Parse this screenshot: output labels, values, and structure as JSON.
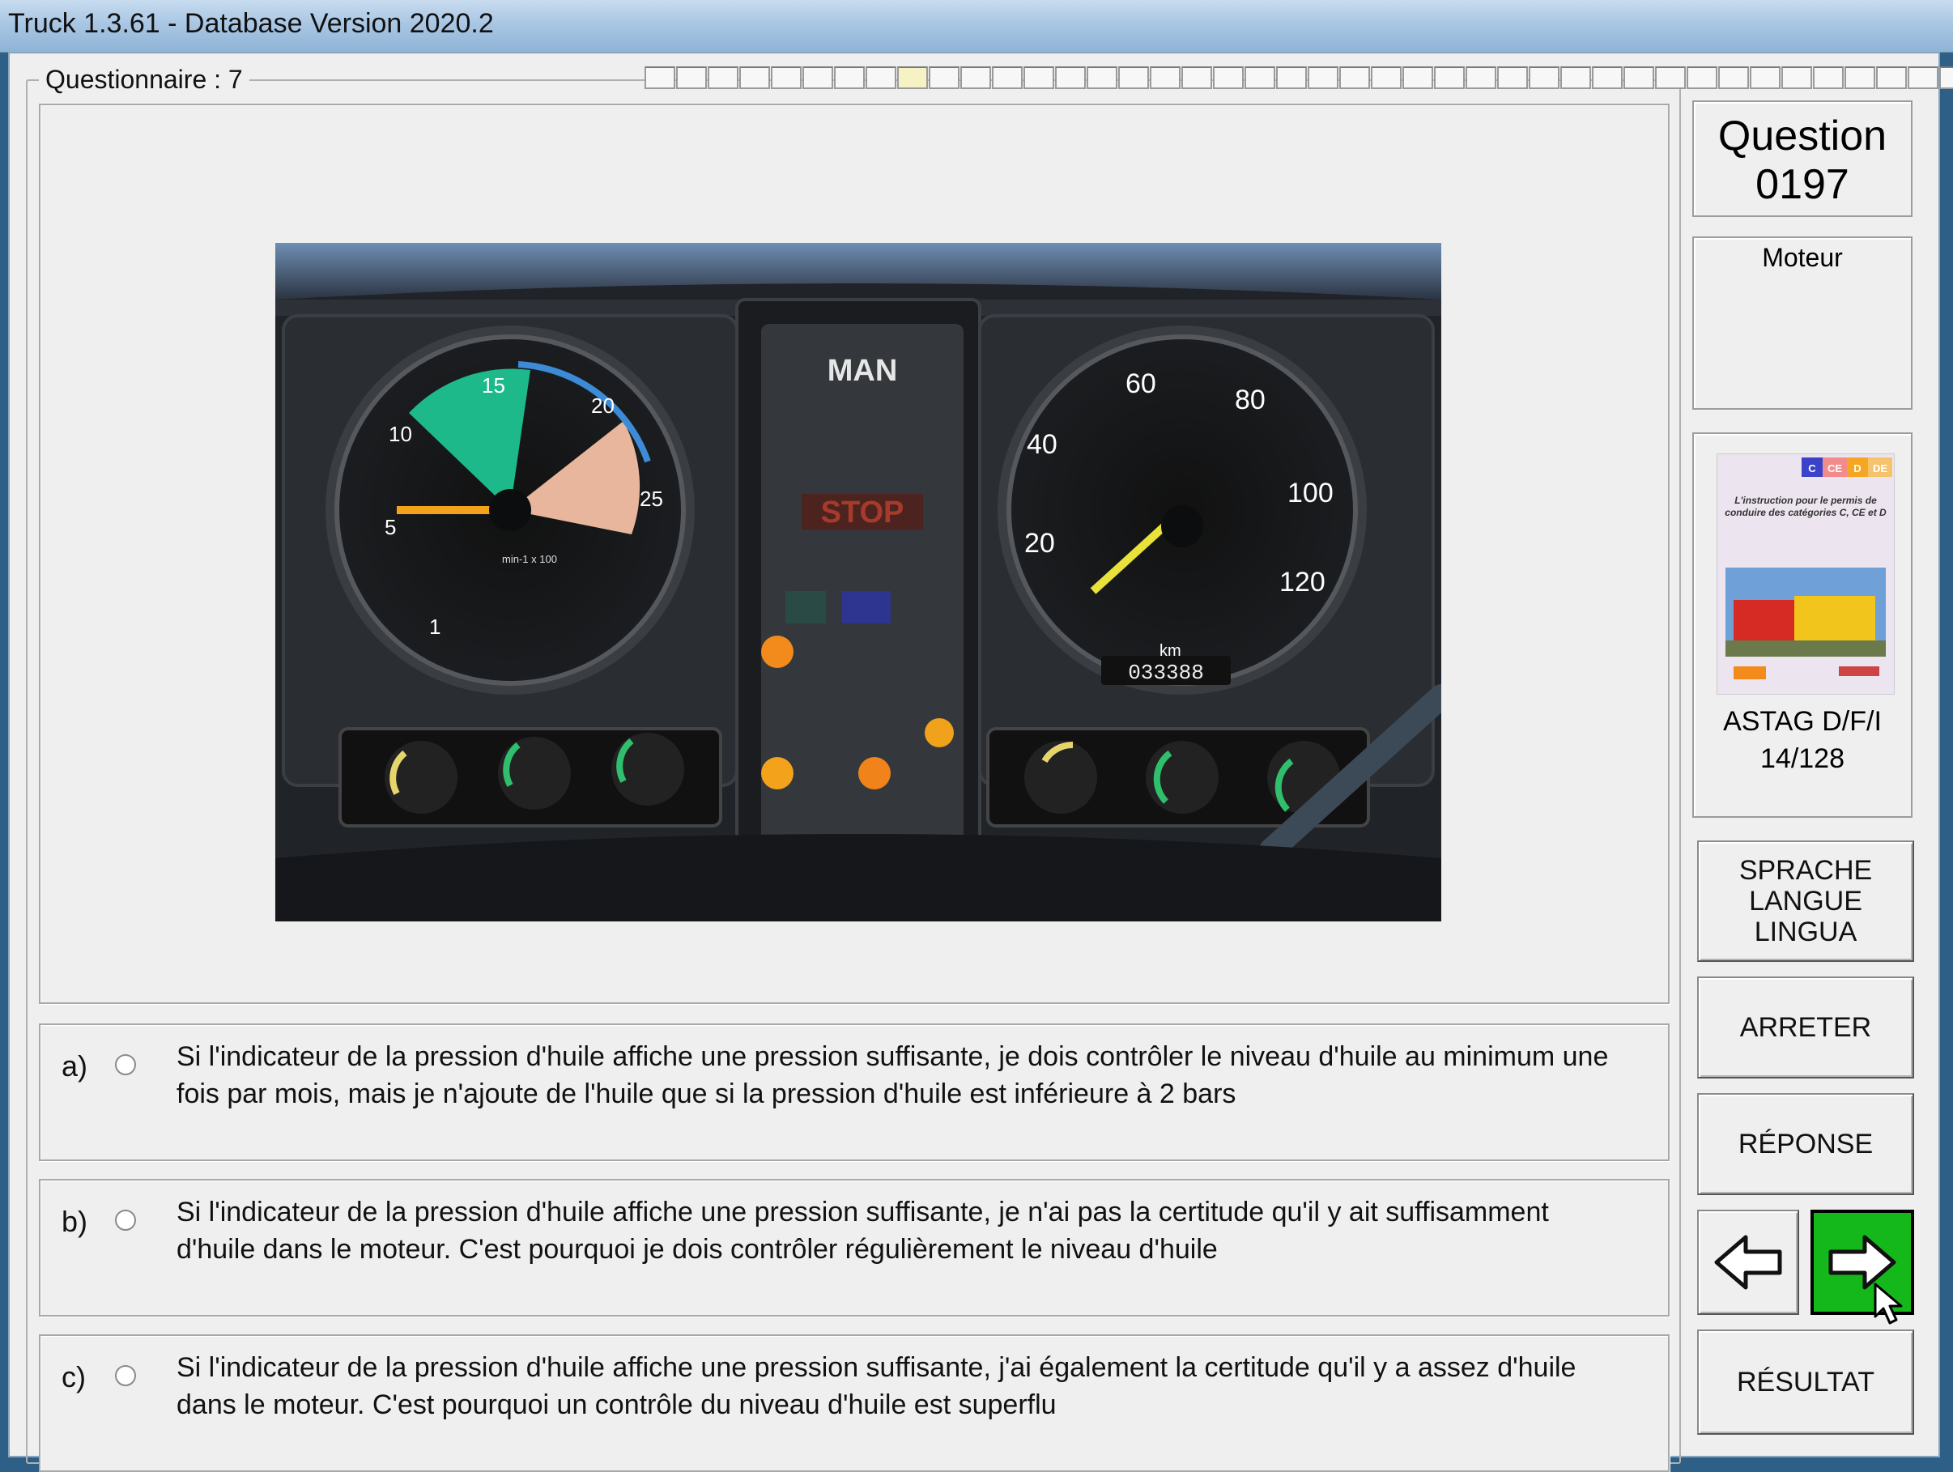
{
  "window": {
    "title": "Truck 1.3.61 - Database Version 2020.2"
  },
  "questionnaire": {
    "label": "Questionnaire : 7"
  },
  "question": {
    "line1": "Question",
    "line2": "0197",
    "category": "Moteur"
  },
  "answers": [
    {
      "letter": "a)",
      "text": "Si l'indicateur de la pression d'huile affiche une pression suffisante, je dois contrôler le niveau d'huile au minimum une fois par mois, mais je n'ajoute de l'huile que si la pression d'huile est inférieure à 2 bars"
    },
    {
      "letter": "b)",
      "text": "Si l'indicateur de la pression d'huile affiche une pression suffisante, je n'ai pas la certitude qu'il y ait suffisamment d'huile dans le moteur. C'est pourquoi je dois contrôler régulièrement le niveau d'huile"
    },
    {
      "letter": "c)",
      "text": "Si l'indicateur de la pression d'huile affiche une pression suffisante, j'ai également la certitude qu'il y a assez d'huile dans le moteur. C'est pourquoi un contrôle du niveau d'huile est superflu"
    }
  ],
  "reference": {
    "name": "ASTAG D/F/I",
    "page": "14/128"
  },
  "cover": {
    "categories": [
      "C",
      "CE",
      "D",
      "DE"
    ],
    "text": "L'instruction pour le permis de conduire des catégories C, CE et D"
  },
  "photo": {
    "brand": "MAN",
    "stop": "STOP",
    "rpm_ticks": [
      "1",
      "5",
      "10",
      "15",
      "20",
      "25"
    ],
    "rpm_unit": "min-1 x 100",
    "speed_ticks": [
      "20",
      "40",
      "60",
      "80",
      "100",
      "120"
    ],
    "speed_unit": "km",
    "odometer": "033388"
  },
  "buttons": {
    "language": [
      "SPRACHE",
      "LANGUE",
      "LINGUA"
    ],
    "stop": "ARRETER",
    "answer": "RÉPONSE",
    "result": "RÉSULTAT"
  },
  "progress": {
    "cells": 42,
    "current": 8
  }
}
